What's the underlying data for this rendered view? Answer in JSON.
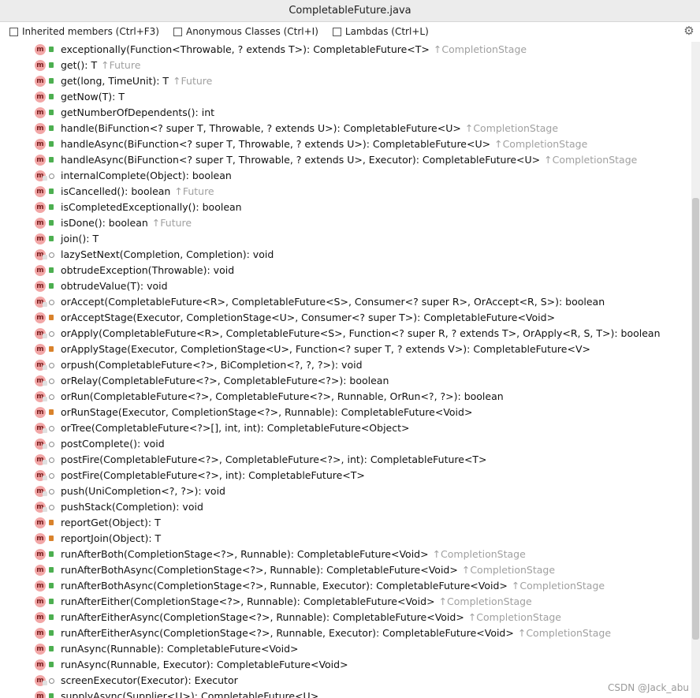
{
  "window": {
    "title": "CompletableFuture.java"
  },
  "options": [
    {
      "label": "Inherited members (Ctrl+F3)"
    },
    {
      "label": "Anonymous Classes (Ctrl+I)"
    },
    {
      "label": "Lambdas (Ctrl+L)"
    }
  ],
  "icons": {
    "method": "m",
    "settings": "gear-icon"
  },
  "colors": {
    "public": "#4caf50",
    "private": "#d9822b",
    "inherited": "#a0a0a0"
  },
  "watermark": "CSDN @Jack_abu",
  "methods": [
    {
      "sig": "exceptionally(Function<Throwable, ? extends T>): CompletableFuture<T>",
      "inherited": "↑CompletionStage",
      "access": "public"
    },
    {
      "sig": "get(): T",
      "inherited": "↑Future",
      "access": "public"
    },
    {
      "sig": "get(long, TimeUnit): T",
      "inherited": "↑Future",
      "access": "public"
    },
    {
      "sig": "getNow(T): T",
      "inherited": "",
      "access": "public"
    },
    {
      "sig": "getNumberOfDependents(): int",
      "inherited": "",
      "access": "public"
    },
    {
      "sig": "handle(BiFunction<? super T, Throwable, ? extends U>): CompletableFuture<U>",
      "inherited": "↑CompletionStage",
      "access": "public"
    },
    {
      "sig": "handleAsync(BiFunction<? super T, Throwable, ? extends U>): CompletableFuture<U>",
      "inherited": "↑CompletionStage",
      "access": "public"
    },
    {
      "sig": "handleAsync(BiFunction<? super T, Throwable, ? extends U>, Executor): CompletableFuture<U>",
      "inherited": "↑CompletionStage",
      "access": "public"
    },
    {
      "sig": "internalComplete(Object): boolean",
      "inherited": "",
      "access": "package"
    },
    {
      "sig": "isCancelled(): boolean",
      "inherited": "↑Future",
      "access": "public"
    },
    {
      "sig": "isCompletedExceptionally(): boolean",
      "inherited": "",
      "access": "public"
    },
    {
      "sig": "isDone(): boolean",
      "inherited": "↑Future",
      "access": "public"
    },
    {
      "sig": "join(): T",
      "inherited": "",
      "access": "public"
    },
    {
      "sig": "lazySetNext(Completion, Completion): void",
      "inherited": "",
      "access": "package"
    },
    {
      "sig": "obtrudeException(Throwable): void",
      "inherited": "",
      "access": "public"
    },
    {
      "sig": "obtrudeValue(T): void",
      "inherited": "",
      "access": "public"
    },
    {
      "sig": "orAccept(CompletableFuture<R>, CompletableFuture<S>, Consumer<? super R>, OrAccept<R, S>): boolean",
      "inherited": "",
      "access": "package"
    },
    {
      "sig": "orAcceptStage(Executor, CompletionStage<U>, Consumer<? super T>): CompletableFuture<Void>",
      "inherited": "",
      "access": "private"
    },
    {
      "sig": "orApply(CompletableFuture<R>, CompletableFuture<S>, Function<? super R, ? extends T>, OrApply<R, S, T>): boolean",
      "inherited": "",
      "access": "package"
    },
    {
      "sig": "orApplyStage(Executor, CompletionStage<U>, Function<? super T, ? extends V>): CompletableFuture<V>",
      "inherited": "",
      "access": "private"
    },
    {
      "sig": "orpush(CompletableFuture<?>, BiCompletion<?, ?, ?>): void",
      "inherited": "",
      "access": "package"
    },
    {
      "sig": "orRelay(CompletableFuture<?>, CompletableFuture<?>): boolean",
      "inherited": "",
      "access": "package"
    },
    {
      "sig": "orRun(CompletableFuture<?>, CompletableFuture<?>, Runnable, OrRun<?, ?>): boolean",
      "inherited": "",
      "access": "package"
    },
    {
      "sig": "orRunStage(Executor, CompletionStage<?>, Runnable): CompletableFuture<Void>",
      "inherited": "",
      "access": "private"
    },
    {
      "sig": "orTree(CompletableFuture<?>[], int, int): CompletableFuture<Object>",
      "inherited": "",
      "access": "package"
    },
    {
      "sig": "postComplete(): void",
      "inherited": "",
      "access": "package"
    },
    {
      "sig": "postFire(CompletableFuture<?>, CompletableFuture<?>, int): CompletableFuture<T>",
      "inherited": "",
      "access": "package"
    },
    {
      "sig": "postFire(CompletableFuture<?>, int): CompletableFuture<T>",
      "inherited": "",
      "access": "package"
    },
    {
      "sig": "push(UniCompletion<?, ?>): void",
      "inherited": "",
      "access": "package"
    },
    {
      "sig": "pushStack(Completion): void",
      "inherited": "",
      "access": "package"
    },
    {
      "sig": "reportGet(Object): T",
      "inherited": "",
      "access": "private"
    },
    {
      "sig": "reportJoin(Object): T",
      "inherited": "",
      "access": "private"
    },
    {
      "sig": "runAfterBoth(CompletionStage<?>, Runnable): CompletableFuture<Void>",
      "inherited": "↑CompletionStage",
      "access": "public"
    },
    {
      "sig": "runAfterBothAsync(CompletionStage<?>, Runnable): CompletableFuture<Void>",
      "inherited": "↑CompletionStage",
      "access": "public"
    },
    {
      "sig": "runAfterBothAsync(CompletionStage<?>, Runnable, Executor): CompletableFuture<Void>",
      "inherited": "↑CompletionStage",
      "access": "public"
    },
    {
      "sig": "runAfterEither(CompletionStage<?>, Runnable): CompletableFuture<Void>",
      "inherited": "↑CompletionStage",
      "access": "public"
    },
    {
      "sig": "runAfterEitherAsync(CompletionStage<?>, Runnable): CompletableFuture<Void>",
      "inherited": "↑CompletionStage",
      "access": "public"
    },
    {
      "sig": "runAfterEitherAsync(CompletionStage<?>, Runnable, Executor): CompletableFuture<Void>",
      "inherited": "↑CompletionStage",
      "access": "public"
    },
    {
      "sig": "runAsync(Runnable): CompletableFuture<Void>",
      "inherited": "",
      "access": "public"
    },
    {
      "sig": "runAsync(Runnable, Executor): CompletableFuture<Void>",
      "inherited": "",
      "access": "public"
    },
    {
      "sig": "screenExecutor(Executor): Executor",
      "inherited": "",
      "access": "package"
    },
    {
      "sig": "supplyAsync(Supplier<U>): CompletableFuture<U>",
      "inherited": "",
      "access": "public"
    }
  ]
}
